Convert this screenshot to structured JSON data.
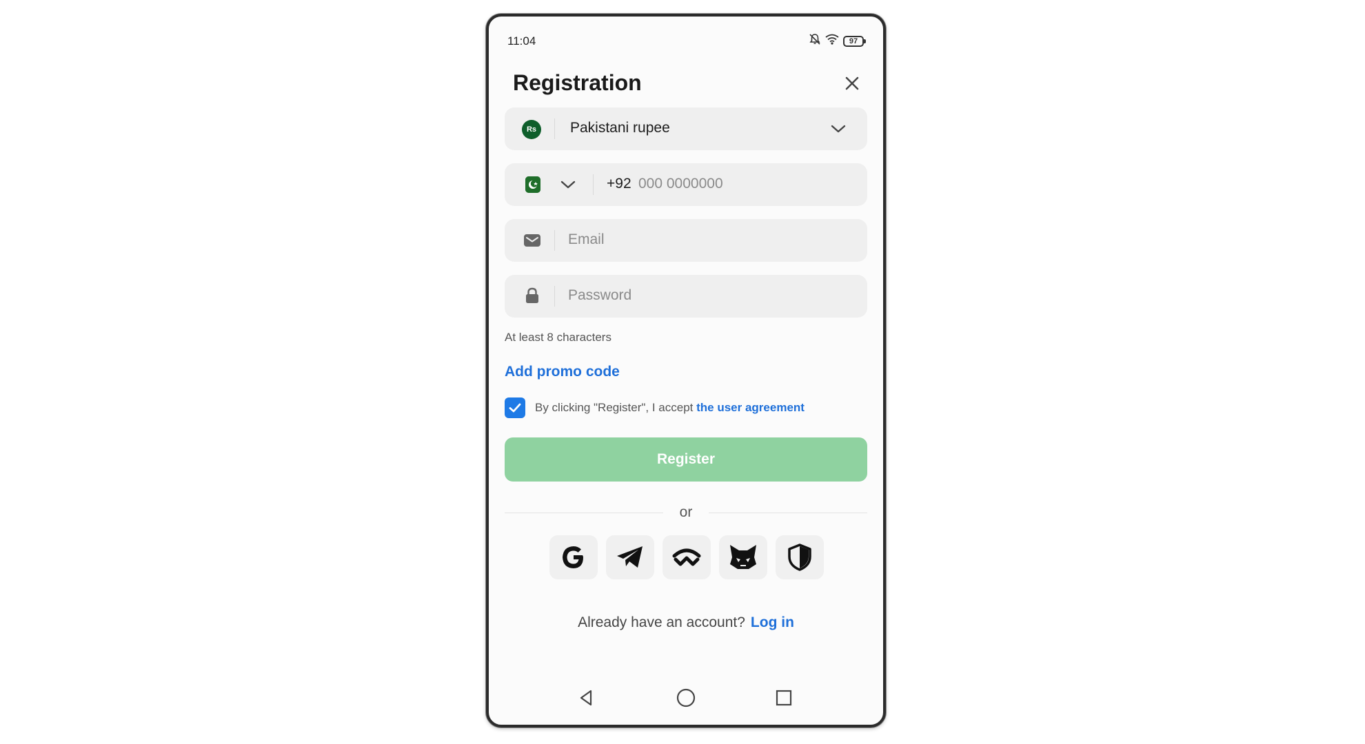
{
  "status_bar": {
    "time": "11:04",
    "battery": "97"
  },
  "header": {
    "title": "Registration"
  },
  "currency": {
    "badge": "Rs",
    "label": "Pakistani rupee"
  },
  "phone": {
    "code": "+92",
    "placeholder": "000 0000000"
  },
  "email": {
    "placeholder": "Email"
  },
  "password": {
    "placeholder": "Password",
    "hint": "At least 8 characters"
  },
  "promo": {
    "label": "Add promo code"
  },
  "agreement": {
    "checked": true,
    "text": "By clicking \"Register\", I accept ",
    "link": "the user agreement"
  },
  "register": {
    "label": "Register"
  },
  "divider": {
    "label": "or"
  },
  "socials": [
    "google-icon",
    "telegram-icon",
    "walletconnect-icon",
    "metamask-icon",
    "shield-icon"
  ],
  "login": {
    "prompt": "Already have an account?",
    "link": "Log in"
  },
  "colors": {
    "accent": "#1e6fd9",
    "register_bg": "#8fd2a0",
    "checkbox": "#1e7ae6"
  }
}
